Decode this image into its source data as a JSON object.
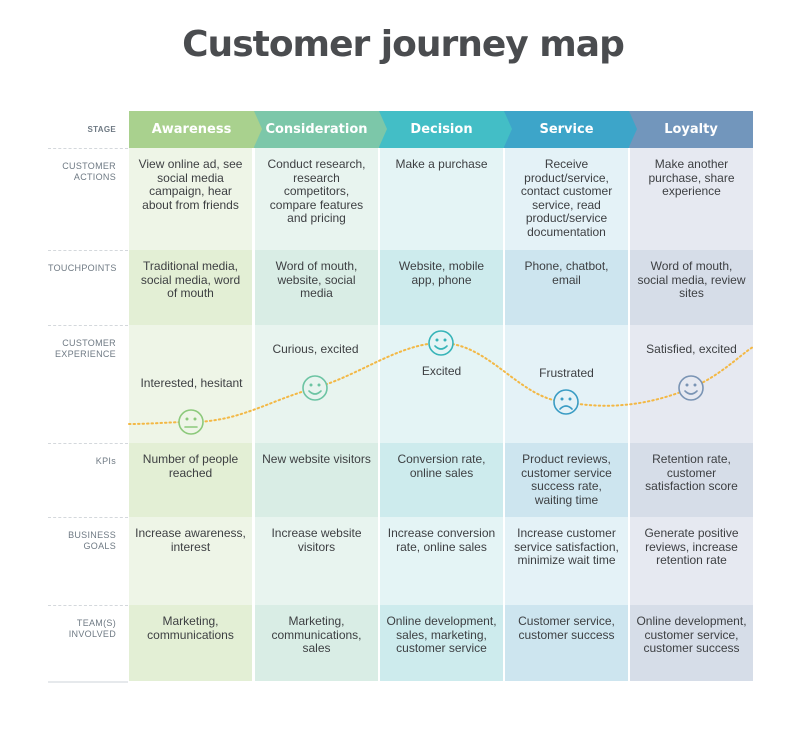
{
  "title": "Customer journey map",
  "row_labels": {
    "stage": "STAGE",
    "customer_actions": "CUSTOMER\nACTIONS",
    "touchpoints": "TOUCHPOINTS",
    "customer_experience": "CUSTOMER\nEXPERIENCE",
    "kpis": "KPIs",
    "business_goals": "BUSINESS\nGOALS",
    "teams_involved": "TEAM(S)\nINVOLVED"
  },
  "stages": [
    {
      "name": "Awareness",
      "header_color": "#a9d18e",
      "cell_color_light": "#eef5e7",
      "cell_color_dark": "#e3efd5",
      "customer_actions": "View online ad, see social media campaign, hear about from friends",
      "touchpoints": "Traditional media, social media, word of mouth",
      "experience_text": "Interested, hesitant",
      "experience_mood": "neutral-face-icon",
      "experience_icon_color": "#8cc97b",
      "kpis": "Number of people reached",
      "business_goals": "Increase awareness, interest",
      "teams_involved": "Marketing, communications"
    },
    {
      "name": "Consideration",
      "header_color": "#7cc7a9",
      "cell_color_light": "#e8f4ef",
      "cell_color_dark": "#d9ede5",
      "customer_actions": "Conduct research, research competitors, compare features and pricing",
      "touchpoints": "Word of mouth, website, social media",
      "experience_text": "Curious, excited",
      "experience_mood": "smile-face-icon",
      "experience_icon_color": "#6cc4a3",
      "kpis": "New website visitors",
      "business_goals": "Increase website visitors",
      "teams_involved": "Marketing, communications, sales"
    },
    {
      "name": "Decision",
      "header_color": "#43bec6",
      "cell_color_light": "#e4f4f5",
      "cell_color_dark": "#cdebed",
      "customer_actions": "Make a purchase",
      "touchpoints": "Website, mobile app, phone",
      "experience_text": "Excited",
      "experience_mood": "smile-face-icon",
      "experience_icon_color": "#36b4b8",
      "kpis": "Conversion rate, online sales",
      "business_goals": "Increase conversion rate, online sales",
      "teams_involved": "Online development, sales, marketing, customer service"
    },
    {
      "name": "Service",
      "header_color": "#3da5c9",
      "cell_color_light": "#e4f2f7",
      "cell_color_dark": "#cde5ef",
      "customer_actions": "Receive product/service, contact customer service, read product/service documentation",
      "touchpoints": "Phone, chatbot, email",
      "experience_text": "Frustrated",
      "experience_mood": "frown-face-icon",
      "experience_icon_color": "#3a9cc4",
      "kpis": "Product reviews, customer service success rate, waiting time",
      "business_goals": "Increase customer service satisfaction, minimize wait time",
      "teams_involved": "Customer service, customer success"
    },
    {
      "name": "Loyalty",
      "header_color": "#7296bc",
      "cell_color_light": "#e6e9f1",
      "cell_color_dark": "#d6dde8",
      "customer_actions": "Make another purchase, share experience",
      "touchpoints": "Word of mouth, social media, review sites",
      "experience_text": "Satisfied, excited",
      "experience_mood": "smile-face-icon",
      "experience_icon_color": "#7a94b4",
      "kpis": "Retention rate, customer satisfaction score",
      "business_goals": "Generate positive reviews, increase retention rate",
      "teams_involved": "Online development, customer service, customer success"
    }
  ],
  "experience_curve_color": "#f3b845"
}
